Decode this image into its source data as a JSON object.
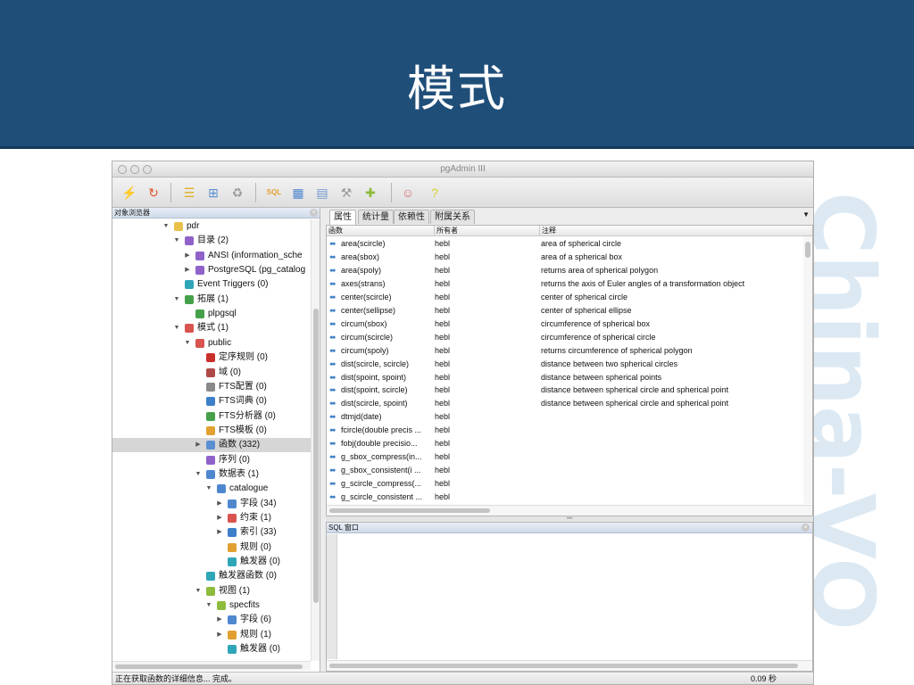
{
  "slide": {
    "title": "模式",
    "watermark": "China-VO"
  },
  "app": {
    "title": "pgAdmin III"
  },
  "toolbar": {
    "buttons": [
      {
        "name": "connect-icon",
        "glyph": "⚡",
        "color": "#b2b2b2"
      },
      {
        "name": "refresh-icon",
        "glyph": "↻",
        "color": "#e0522b"
      },
      {
        "name": "properties-icon",
        "glyph": "☰",
        "color": "#e2b020"
      },
      {
        "name": "create-object-icon",
        "glyph": "⊞",
        "color": "#5b8fd4"
      },
      {
        "name": "drop-object-icon",
        "glyph": "♻",
        "color": "#9a9a9a"
      },
      {
        "name": "query-tool-icon",
        "glyph": "SQL",
        "color": "#e2a030"
      },
      {
        "name": "view-data-icon",
        "glyph": "▦",
        "color": "#4f87cf"
      },
      {
        "name": "filtered-data-icon",
        "glyph": "▤",
        "color": "#6f99cf"
      },
      {
        "name": "maintenance-icon",
        "glyph": "⚒",
        "color": "#9a9a9a"
      },
      {
        "name": "plugins-icon",
        "glyph": "✚",
        "color": "#8dbb3c"
      },
      {
        "name": "guru-hint-icon",
        "glyph": "☺",
        "color": "#d66d6d"
      },
      {
        "name": "help-icon",
        "glyph": "?",
        "color": "#d9d22b"
      }
    ]
  },
  "browser": {
    "title": "对象浏览器",
    "close_glyph": "×",
    "items": [
      {
        "label": "pdr",
        "level": 0,
        "arrow": "▼",
        "icon": "database-icon",
        "color": "#e9c14a",
        "selected": false
      },
      {
        "label": "目录 (2)",
        "level": 1,
        "arrow": "▼",
        "icon": "catalogs-icon",
        "color": "#8e62c9",
        "selected": false
      },
      {
        "label": "ANSI (information_sche",
        "level": 2,
        "arrow": "▶",
        "icon": "catalog-icon",
        "color": "#8e62c9",
        "selected": false
      },
      {
        "label": "PostgreSQL (pg_catalog",
        "level": 2,
        "arrow": "▶",
        "icon": "catalog-icon",
        "color": "#8e62c9",
        "selected": false
      },
      {
        "label": "Event Triggers (0)",
        "level": 1,
        "arrow": "",
        "icon": "event-triggers-icon",
        "color": "#2fa5b8",
        "selected": false
      },
      {
        "label": "拓展 (1)",
        "level": 1,
        "arrow": "▼",
        "icon": "extensions-icon",
        "color": "#46a04a",
        "selected": false
      },
      {
        "label": "plpgsql",
        "level": 2,
        "arrow": "",
        "icon": "extension-icon",
        "color": "#46a04a",
        "selected": false
      },
      {
        "label": "模式 (1)",
        "level": 1,
        "arrow": "▼",
        "icon": "schemas-icon",
        "color": "#d9534f",
        "selected": false
      },
      {
        "label": "public",
        "level": 2,
        "arrow": "▼",
        "icon": "schema-icon",
        "color": "#d9534f",
        "selected": false
      },
      {
        "label": "定序规则 (0)",
        "level": 3,
        "arrow": "",
        "icon": "collations-icon",
        "color": "#c9302c",
        "selected": false
      },
      {
        "label": "域 (0)",
        "level": 3,
        "arrow": "",
        "icon": "domains-icon",
        "color": "#b04a4a",
        "selected": false
      },
      {
        "label": "FTS配置 (0)",
        "level": 3,
        "arrow": "",
        "icon": "fts-configurations-icon",
        "color": "#8a8a8a",
        "selected": false
      },
      {
        "label": "FTS词典 (0)",
        "level": 3,
        "arrow": "",
        "icon": "fts-dictionaries-icon",
        "color": "#3d7fc9",
        "selected": false
      },
      {
        "label": "FTS分析器 (0)",
        "level": 3,
        "arrow": "",
        "icon": "fts-parsers-icon",
        "color": "#46a04a",
        "selected": false
      },
      {
        "label": "FTS模板 (0)",
        "level": 3,
        "arrow": "",
        "icon": "fts-templates-icon",
        "color": "#e2a030",
        "selected": false
      },
      {
        "label": "函数 (332)",
        "level": 3,
        "arrow": "▶",
        "icon": "functions-icon",
        "color": "#5b8fd4",
        "selected": true
      },
      {
        "label": "序列 (0)",
        "level": 3,
        "arrow": "",
        "icon": "sequences-icon",
        "color": "#8e62c9",
        "selected": false
      },
      {
        "label": "数据表 (1)",
        "level": 3,
        "arrow": "▼",
        "icon": "tables-icon",
        "color": "#4f87cf",
        "selected": false
      },
      {
        "label": "catalogue",
        "level": 4,
        "arrow": "▼",
        "icon": "table-icon",
        "color": "#4f87cf",
        "selected": false
      },
      {
        "label": "字段 (34)",
        "level": 5,
        "arrow": "▶",
        "icon": "columns-icon",
        "color": "#4f87cf",
        "selected": false
      },
      {
        "label": "约束 (1)",
        "level": 5,
        "arrow": "▶",
        "icon": "constraints-icon",
        "color": "#d9534f",
        "selected": false
      },
      {
        "label": "索引 (33)",
        "level": 5,
        "arrow": "▶",
        "icon": "indexes-icon",
        "color": "#3d7fc9",
        "selected": false
      },
      {
        "label": "规则 (0)",
        "level": 5,
        "arrow": "",
        "icon": "rules-icon",
        "color": "#e2a030",
        "selected": false
      },
      {
        "label": "触发器 (0)",
        "level": 5,
        "arrow": "",
        "icon": "triggers-icon",
        "color": "#2fa5b8",
        "selected": false
      },
      {
        "label": "触发器函数 (0)",
        "level": 3,
        "arrow": "",
        "icon": "trigger-functions-icon",
        "color": "#2fa5b8",
        "selected": false
      },
      {
        "label": "视图 (1)",
        "level": 3,
        "arrow": "▼",
        "icon": "views-icon",
        "color": "#8dbb3c",
        "selected": false
      },
      {
        "label": "specfits",
        "level": 4,
        "arrow": "▼",
        "icon": "view-icon",
        "color": "#8dbb3c",
        "selected": false
      },
      {
        "label": "字段 (6)",
        "level": 5,
        "arrow": "▶",
        "icon": "columns-icon",
        "color": "#4f87cf",
        "selected": false
      },
      {
        "label": "规则 (1)",
        "level": 5,
        "arrow": "▶",
        "icon": "rules-icon",
        "color": "#e2a030",
        "selected": false
      },
      {
        "label": "触发器 (0)",
        "level": 5,
        "arrow": "",
        "icon": "triggers-icon",
        "color": "#2fa5b8",
        "selected": false
      }
    ]
  },
  "properties": {
    "tabs": [
      "属性",
      "统计量",
      "依赖性",
      "附属关系"
    ],
    "active_tab": 0,
    "menu_glyph": "▼",
    "columns": [
      "函数",
      "所有者",
      "注释"
    ],
    "rows": [
      {
        "name": "area(scircle)",
        "owner": "hebl",
        "comment": "area of spherical circle"
      },
      {
        "name": "area(sbox)",
        "owner": "hebl",
        "comment": "area of a spherical box"
      },
      {
        "name": "area(spoly)",
        "owner": "hebl",
        "comment": "returns area of spherical polygon"
      },
      {
        "name": "axes(strans)",
        "owner": "hebl",
        "comment": "returns the axis of Euler angles of a transformation object"
      },
      {
        "name": "center(scircle)",
        "owner": "hebl",
        "comment": "center of spherical circle"
      },
      {
        "name": "center(sellipse)",
        "owner": "hebl",
        "comment": "center of spherical ellipse"
      },
      {
        "name": "circum(sbox)",
        "owner": "hebl",
        "comment": "circumference of spherical box"
      },
      {
        "name": "circum(scircle)",
        "owner": "hebl",
        "comment": "circumference of spherical circle"
      },
      {
        "name": "circum(spoly)",
        "owner": "hebl",
        "comment": "returns circumference of spherical polygon"
      },
      {
        "name": "dist(scircle, scircle)",
        "owner": "hebl",
        "comment": "distance between two spherical circles"
      },
      {
        "name": "dist(spoint, spoint)",
        "owner": "hebl",
        "comment": "distance between spherical points"
      },
      {
        "name": "dist(spoint, scircle)",
        "owner": "hebl",
        "comment": "distance between spherical circle and spherical point"
      },
      {
        "name": "dist(scircle, spoint)",
        "owner": "hebl",
        "comment": "distance between spherical circle and spherical point"
      },
      {
        "name": "dtmjd(date)",
        "owner": "hebl",
        "comment": ""
      },
      {
        "name": "fcircle(double precis ...",
        "owner": "hebl",
        "comment": ""
      },
      {
        "name": "fobj(double precisio...",
        "owner": "hebl",
        "comment": ""
      },
      {
        "name": "g_sbox_compress(in...",
        "owner": "hebl",
        "comment": ""
      },
      {
        "name": "g_sbox_consistent(i ...",
        "owner": "hebl",
        "comment": ""
      },
      {
        "name": "g_scircle_compress(...",
        "owner": "hebl",
        "comment": ""
      },
      {
        "name": "g_scircle_consistent ...",
        "owner": "hebl",
        "comment": ""
      }
    ]
  },
  "sql_pane": {
    "title": "SQL 窗口",
    "close_glyph": "×",
    "content": ""
  },
  "status": {
    "text": "正在获取函数的详细信息... 完成。",
    "time": "0.09 秒"
  },
  "colors": {
    "header_bg": "#1f4e79",
    "selected_row": "#d6d6d6",
    "function_icon": "#3f7fc5"
  }
}
